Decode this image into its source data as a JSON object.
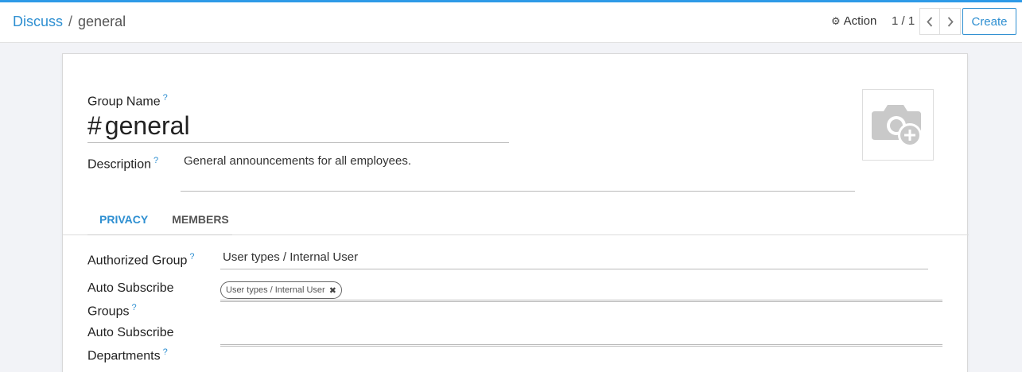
{
  "breadcrumb": {
    "parent": "Discuss",
    "separator": "/",
    "current": "general"
  },
  "toolbar": {
    "action_label": "Action",
    "pager_value": "1 / 1",
    "create_label": "Create"
  },
  "form": {
    "group_name_label": "Group Name",
    "help_mark": "?",
    "name_prefix": "#",
    "name_value": "general",
    "description_label": "Description",
    "description_value": "General announcements for all employees.",
    "tabs": [
      {
        "label": "PRIVACY",
        "active": true
      },
      {
        "label": "MEMBERS",
        "active": false
      }
    ],
    "authorized_group_label": "Authorized Group",
    "authorized_group_value": "User types / Internal User",
    "auto_subscribe_groups_label_1": "Auto Subscribe",
    "auto_subscribe_groups_label_2": "Groups",
    "auto_subscribe_groups_tag": "User types / Internal User",
    "auto_subscribe_departments_label_1": "Auto Subscribe",
    "auto_subscribe_departments_label_2": "Departments"
  },
  "icons": {
    "gear": "gear-icon",
    "prev": "chevron-left-icon",
    "next": "chevron-right-icon",
    "avatar": "camera-add-icon",
    "tag_remove": "close-icon"
  },
  "colors": {
    "accent": "#2e8fd1",
    "topline": "#2e9ae7",
    "background": "#f2f3f7"
  }
}
